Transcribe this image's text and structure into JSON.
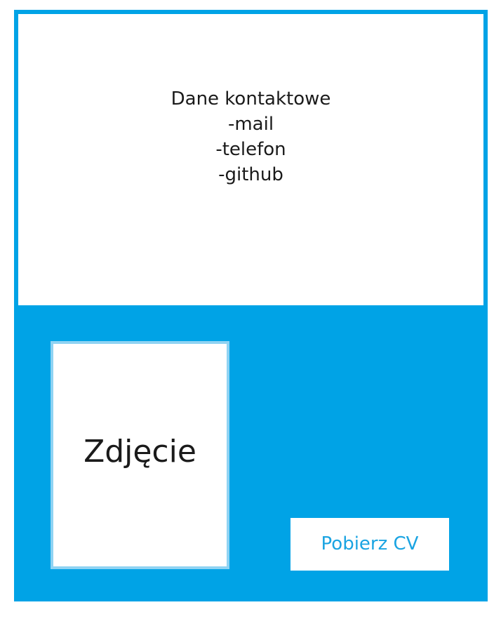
{
  "contact": {
    "title": "Dane kontaktowe",
    "items": [
      "-mail",
      "-telefon",
      "-github"
    ]
  },
  "photo": {
    "label": "Zdjęcie"
  },
  "download": {
    "label": "Pobierz CV"
  },
  "colors": {
    "background": "#00a3e6",
    "panel": "#ffffff",
    "photo_border": "#8fd3f3",
    "button_text": "#1aa4e2",
    "text": "#1a1a1a"
  }
}
